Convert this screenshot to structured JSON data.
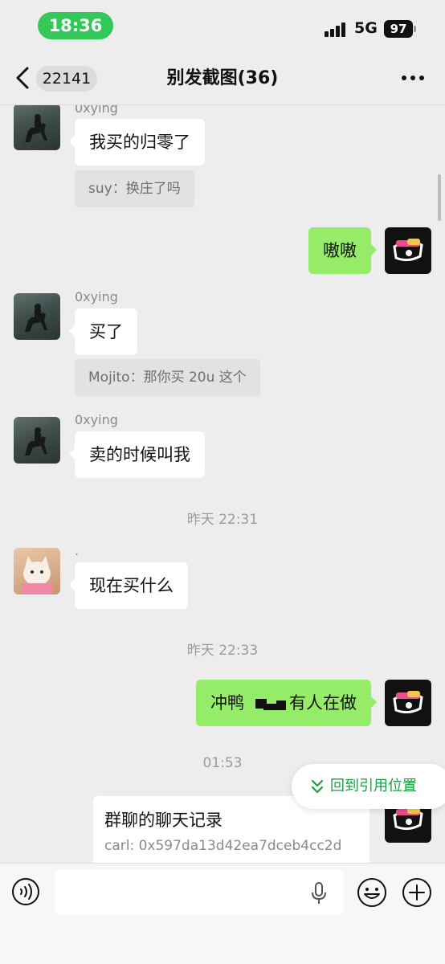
{
  "status_bar": {
    "time": "18:36",
    "network": "5G",
    "battery": "97"
  },
  "header": {
    "unread_count": "22141",
    "title": "别发截图(36)"
  },
  "messages": [
    {
      "sender": "0xying",
      "text": "我买的归零了",
      "quote": "suy：换庄了吗"
    },
    {
      "self_text": "嗷嗷"
    },
    {
      "sender": "0xying",
      "text": "买了",
      "quote": "Mojito：那你买 20u 这个"
    },
    {
      "sender": "0xying",
      "text": "卖的时候叫我"
    },
    {
      "timestamp": "昨天 22:31"
    },
    {
      "sender": ".",
      "text": "现在买什么"
    },
    {
      "timestamp": "昨天 22:33"
    },
    {
      "self_text_before": "冲鸭",
      "self_text_after": "有人在做"
    },
    {
      "timestamp": "01:53"
    },
    {
      "card_title": "群聊的聊天记录",
      "card_sub": "carl: 0x597da13d42ea7dceb4cc2d"
    }
  ],
  "jump_button": {
    "label": "回到引用位置"
  },
  "input_bar": {
    "placeholder": ""
  }
}
